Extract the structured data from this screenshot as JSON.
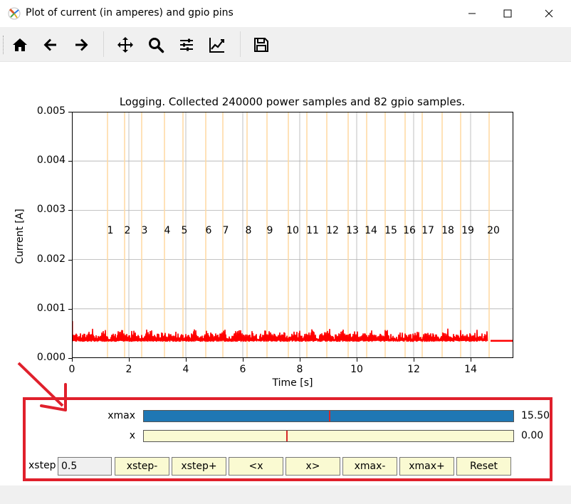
{
  "window": {
    "title": "Plot of current (in amperes) and gpio pins",
    "controls": [
      "minimize",
      "maximize",
      "close"
    ]
  },
  "toolbar": {
    "buttons": [
      {
        "name": "home-icon",
        "label": "Home"
      },
      {
        "name": "back-icon",
        "label": "Back"
      },
      {
        "name": "forward-icon",
        "label": "Forward"
      },
      {
        "name": "pan-icon",
        "label": "Pan"
      },
      {
        "name": "zoom-icon",
        "label": "Zoom"
      },
      {
        "name": "configure-subplots-icon",
        "label": "Configure subplots"
      },
      {
        "name": "edit-axis-icon",
        "label": "Edit axis"
      },
      {
        "name": "save-icon",
        "label": "Save"
      }
    ]
  },
  "chart_data": {
    "type": "line",
    "title": "Logging. Collected 240000 power samples and 82 gpio samples.",
    "xlabel": "Time [s]",
    "ylabel": "Current [A]",
    "xlim": [
      0,
      15.5
    ],
    "ylim": [
      0,
      0.005
    ],
    "x_ticks": [
      "0",
      "2",
      "4",
      "6",
      "8",
      "10",
      "12",
      "14"
    ],
    "y_ticks": [
      "0.000",
      "0.001",
      "0.002",
      "0.003",
      "0.004",
      "0.005"
    ],
    "grid": true,
    "series": [
      {
        "color": "#ff0000",
        "x": [
          0,
          0.5,
          1.0,
          1.5,
          2.0,
          2.5,
          3.0,
          3.5,
          4.0,
          4.5,
          5.0,
          5.5,
          6.0,
          6.5,
          7.0,
          7.5,
          8.0,
          8.5,
          9.0,
          9.5,
          10.0,
          10.5,
          11.0,
          11.5,
          12.0,
          12.5,
          13.0,
          13.5,
          14.0,
          14.6,
          14.7,
          15.5
        ],
        "values": [
          0.00042,
          0.00048,
          0.00044,
          0.00047,
          0.00045,
          0.00046,
          0.00044,
          0.00047,
          0.00045,
          0.00046,
          0.00044,
          0.00047,
          0.00045,
          0.00046,
          0.00044,
          0.00047,
          0.00045,
          0.00046,
          0.00044,
          0.00047,
          0.00045,
          0.00046,
          0.00044,
          0.00047,
          0.00045,
          0.00046,
          0.00044,
          0.00047,
          0.00045,
          0.00046,
          0.00035,
          0.00035
        ],
        "band_min": 0.00033,
        "band_max": 0.00062
      }
    ],
    "gpio_lines": {
      "color": "#ffd9a0",
      "x": [
        1.25,
        1.85,
        2.45,
        3.25,
        3.9,
        4.7,
        5.3,
        6.15,
        6.85,
        7.6,
        8.25,
        8.95,
        9.7,
        10.35,
        11.0,
        11.7,
        12.3,
        13.0,
        13.65,
        14.65
      ]
    },
    "gpio_labels": {
      "y": 0.0026,
      "labels": [
        "1",
        "2",
        "3",
        "4",
        "5",
        "6",
        "7",
        "8",
        "9",
        "10",
        "11",
        "12",
        "13",
        "14",
        "15",
        "16",
        "17",
        "18",
        "19",
        "20"
      ],
      "x": [
        1.35,
        1.95,
        2.55,
        3.35,
        3.95,
        4.8,
        5.4,
        6.2,
        6.95,
        7.75,
        8.45,
        9.15,
        9.85,
        10.5,
        11.2,
        11.85,
        12.5,
        13.2,
        13.9,
        14.8
      ]
    }
  },
  "sliders": [
    {
      "name": "xmax-slider",
      "label": "xmax",
      "value_text": "15.50",
      "fill": 1.0,
      "marker": 0.5,
      "fill_color": "#1f77b4"
    },
    {
      "name": "x-slider",
      "label": "x",
      "value_text": "0.00",
      "fill": 0.0,
      "marker": 0.385,
      "fill_color": "#1f77b4"
    }
  ],
  "controls": {
    "xstep_label": "xstep",
    "xstep_value": "0.5",
    "buttons": [
      "xstep-",
      "xstep+",
      "<x",
      "x>",
      "xmax-",
      "xmax+",
      "Reset"
    ]
  },
  "colors": {
    "annotation": "#e0202c",
    "slider_bg": "#fafad2",
    "marker": "#d62728"
  }
}
